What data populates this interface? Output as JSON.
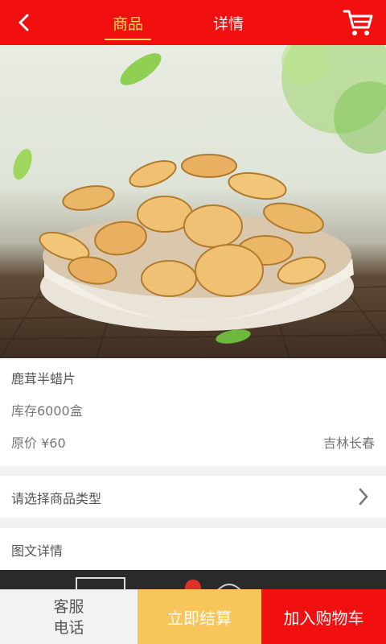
{
  "header": {
    "tabs": [
      {
        "label": "商品",
        "active": true
      },
      {
        "label": "详情",
        "active": false
      }
    ],
    "back_icon": "chevron-left-icon",
    "cart_icon": "shopping-cart-icon",
    "accent": "#f10f0f",
    "active_tab_color": "#ffd75e"
  },
  "banner": {
    "slide_count": 2,
    "active_slide": 1
  },
  "product": {
    "name": "鹿茸半蜡片",
    "stock": "库存6000盒",
    "price": "原价 ¥60",
    "origin": "吉林长春"
  },
  "options": {
    "select_type": "请选择商品类型",
    "chevron_icon": "chevron-right-icon"
  },
  "details": {
    "label": "图文详情"
  },
  "bottom_bar": {
    "service_line1": "客服",
    "service_line2": "电话",
    "checkout": "立即结算",
    "add_to_cart": "加入购物车",
    "checkout_color": "#f7c55a",
    "add_to_cart_color": "#f10f0f"
  }
}
